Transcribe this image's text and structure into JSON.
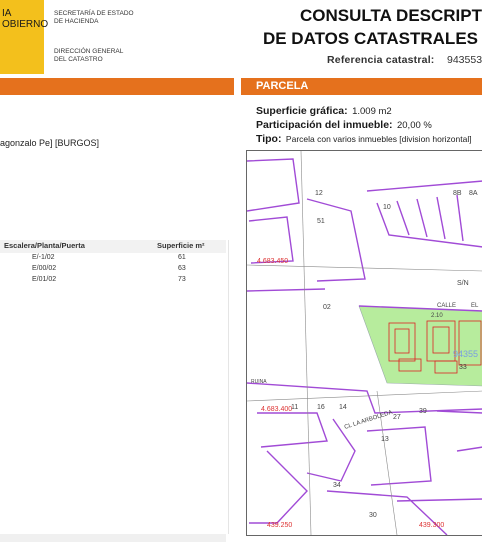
{
  "header": {
    "gov_line1": "IA",
    "gov_line2": "OBIERNO",
    "secretaria_1": "SECRETARÍA DE ESTADO",
    "secretaria_2": "DE HACIENDA",
    "direccion_1": "DIRECCIÓN GENERAL",
    "direccion_2": "DEL CATASTRO",
    "title_line1": "CONSULTA DESCRIPT",
    "title_line2": "DE DATOS CATASTRALES",
    "ref_label": "Referencia catastral:",
    "ref_value": "943553"
  },
  "parcela": {
    "title": "PARCELA",
    "superficie_label": "Superficie gráfica:",
    "superficie_value": "1.009 m2",
    "participacion_label": "Participación del inmueble:",
    "participacion_value": "20,00 %",
    "tipo_label": "Tipo:",
    "tipo_value": "Parcela con varios inmuebles [division horizontal]"
  },
  "inmueble": {
    "address": "agonzalo Pe] [BURGOS]"
  },
  "table": {
    "col1": "Escalera/Planta/Puerta",
    "col2": "Superficie m²",
    "rows": [
      {
        "loc": "E/-1/02",
        "sup": "61"
      },
      {
        "loc": "E/00/02",
        "sup": "63"
      },
      {
        "loc": "E/01/02",
        "sup": "73"
      }
    ]
  },
  "map_labels": {
    "coord_top": "4.683.450",
    "coord_mid": "4.683.400",
    "coord_bot1": "439.250",
    "coord_bot2": "439.300",
    "street1": "S/N",
    "street2": "CALLE",
    "street3": "EL",
    "street4": "CL LA ARBOLEDA",
    "parcel_ref": "94355",
    "n02": "02",
    "n27": "27",
    "n39": "39",
    "n33": "33",
    "n51": "51",
    "n12": "12",
    "n11": "11",
    "n14": "14",
    "n16": "16",
    "n10": "10",
    "n8b": "8B",
    "n8a": "8A",
    "n210": "2.10",
    "n13": "13",
    "n34": "34",
    "n30": "30",
    "ruina": "RUINA"
  }
}
